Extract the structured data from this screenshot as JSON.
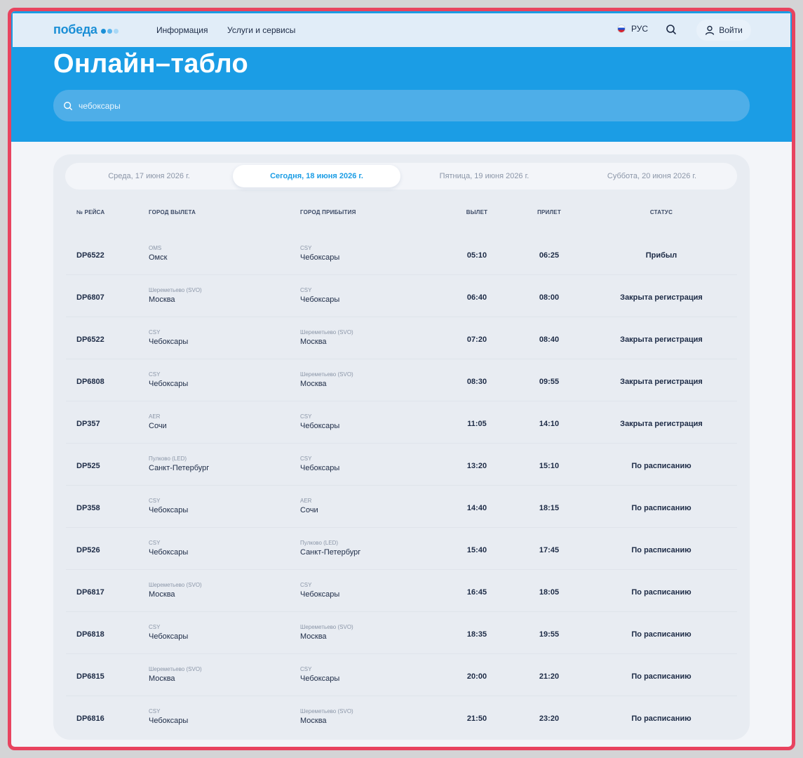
{
  "header": {
    "logo_text": "победа",
    "logo_dot_colors": [
      "#1b8fd6",
      "#5fb7ee",
      "#a9d8f6"
    ],
    "nav": [
      "Информация",
      "Услуги и сервисы"
    ],
    "lang": "РУС",
    "login": "Войти"
  },
  "page": {
    "title": "Онлайн–табло",
    "search_value": "чебоксары"
  },
  "tabs": [
    {
      "label": "Среда, 17 июня 2026 г.",
      "active": false
    },
    {
      "label": "Сегодня, 18 июня 2026 г.",
      "active": true
    },
    {
      "label": "Пятница, 19 июня 2026 г.",
      "active": false
    },
    {
      "label": "Суббота, 20 июня 2026 г.",
      "active": false
    }
  ],
  "columns": {
    "flight": "№ РЕЙСА",
    "from": "ГОРОД ВЫЛЕТА",
    "to": "ГОРОД ПРИБЫТИЯ",
    "dep": "ВЫЛЕТ",
    "arr": "ПРИЛЕТ",
    "status": "СТАТУС"
  },
  "flights": [
    {
      "flight": "DP6522",
      "from_code": "OMS",
      "from_city": "Омск",
      "to_code": "CSY",
      "to_city": "Чебоксары",
      "dep": "05:10",
      "arr": "06:25",
      "status": "Прибыл"
    },
    {
      "flight": "DP6807",
      "from_code": "Шереметьево (SVO)",
      "from_city": "Москва",
      "to_code": "CSY",
      "to_city": "Чебоксары",
      "dep": "06:40",
      "arr": "08:00",
      "status": "Закрыта регистрация"
    },
    {
      "flight": "DP6522",
      "from_code": "CSY",
      "from_city": "Чебоксары",
      "to_code": "Шереметьево (SVO)",
      "to_city": "Москва",
      "dep": "07:20",
      "arr": "08:40",
      "status": "Закрыта регистрация"
    },
    {
      "flight": "DP6808",
      "from_code": "CSY",
      "from_city": "Чебоксары",
      "to_code": "Шереметьево (SVO)",
      "to_city": "Москва",
      "dep": "08:30",
      "arr": "09:55",
      "status": "Закрыта регистрация"
    },
    {
      "flight": "DP357",
      "from_code": "AER",
      "from_city": "Сочи",
      "to_code": "CSY",
      "to_city": "Чебоксары",
      "dep": "11:05",
      "arr": "14:10",
      "status": "Закрыта регистрация"
    },
    {
      "flight": "DP525",
      "from_code": "Пулково (LED)",
      "from_city": "Санкт-Петербург",
      "to_code": "CSY",
      "to_city": "Чебоксары",
      "dep": "13:20",
      "arr": "15:10",
      "status": "По расписанию"
    },
    {
      "flight": "DP358",
      "from_code": "CSY",
      "from_city": "Чебоксары",
      "to_code": "AER",
      "to_city": "Сочи",
      "dep": "14:40",
      "arr": "18:15",
      "status": "По расписанию"
    },
    {
      "flight": "DP526",
      "from_code": "CSY",
      "from_city": "Чебоксары",
      "to_code": "Пулково (LED)",
      "to_city": "Санкт-Петербург",
      "dep": "15:40",
      "arr": "17:45",
      "status": "По расписанию"
    },
    {
      "flight": "DP6817",
      "from_code": "Шереметьево (SVO)",
      "from_city": "Москва",
      "to_code": "CSY",
      "to_city": "Чебоксары",
      "dep": "16:45",
      "arr": "18:05",
      "status": "По расписанию"
    },
    {
      "flight": "DP6818",
      "from_code": "CSY",
      "from_city": "Чебоксары",
      "to_code": "Шереметьево (SVO)",
      "to_city": "Москва",
      "dep": "18:35",
      "arr": "19:55",
      "status": "По расписанию"
    },
    {
      "flight": "DP6815",
      "from_code": "Шереметьево (SVO)",
      "from_city": "Москва",
      "to_code": "CSY",
      "to_city": "Чебоксары",
      "dep": "20:00",
      "arr": "21:20",
      "status": "По расписанию"
    },
    {
      "flight": "DP6816",
      "from_code": "CSY",
      "from_city": "Чебоксары",
      "to_code": "Шереметьево (SVO)",
      "to_city": "Москва",
      "dep": "21:50",
      "arr": "23:20",
      "status": "По расписанию"
    }
  ]
}
